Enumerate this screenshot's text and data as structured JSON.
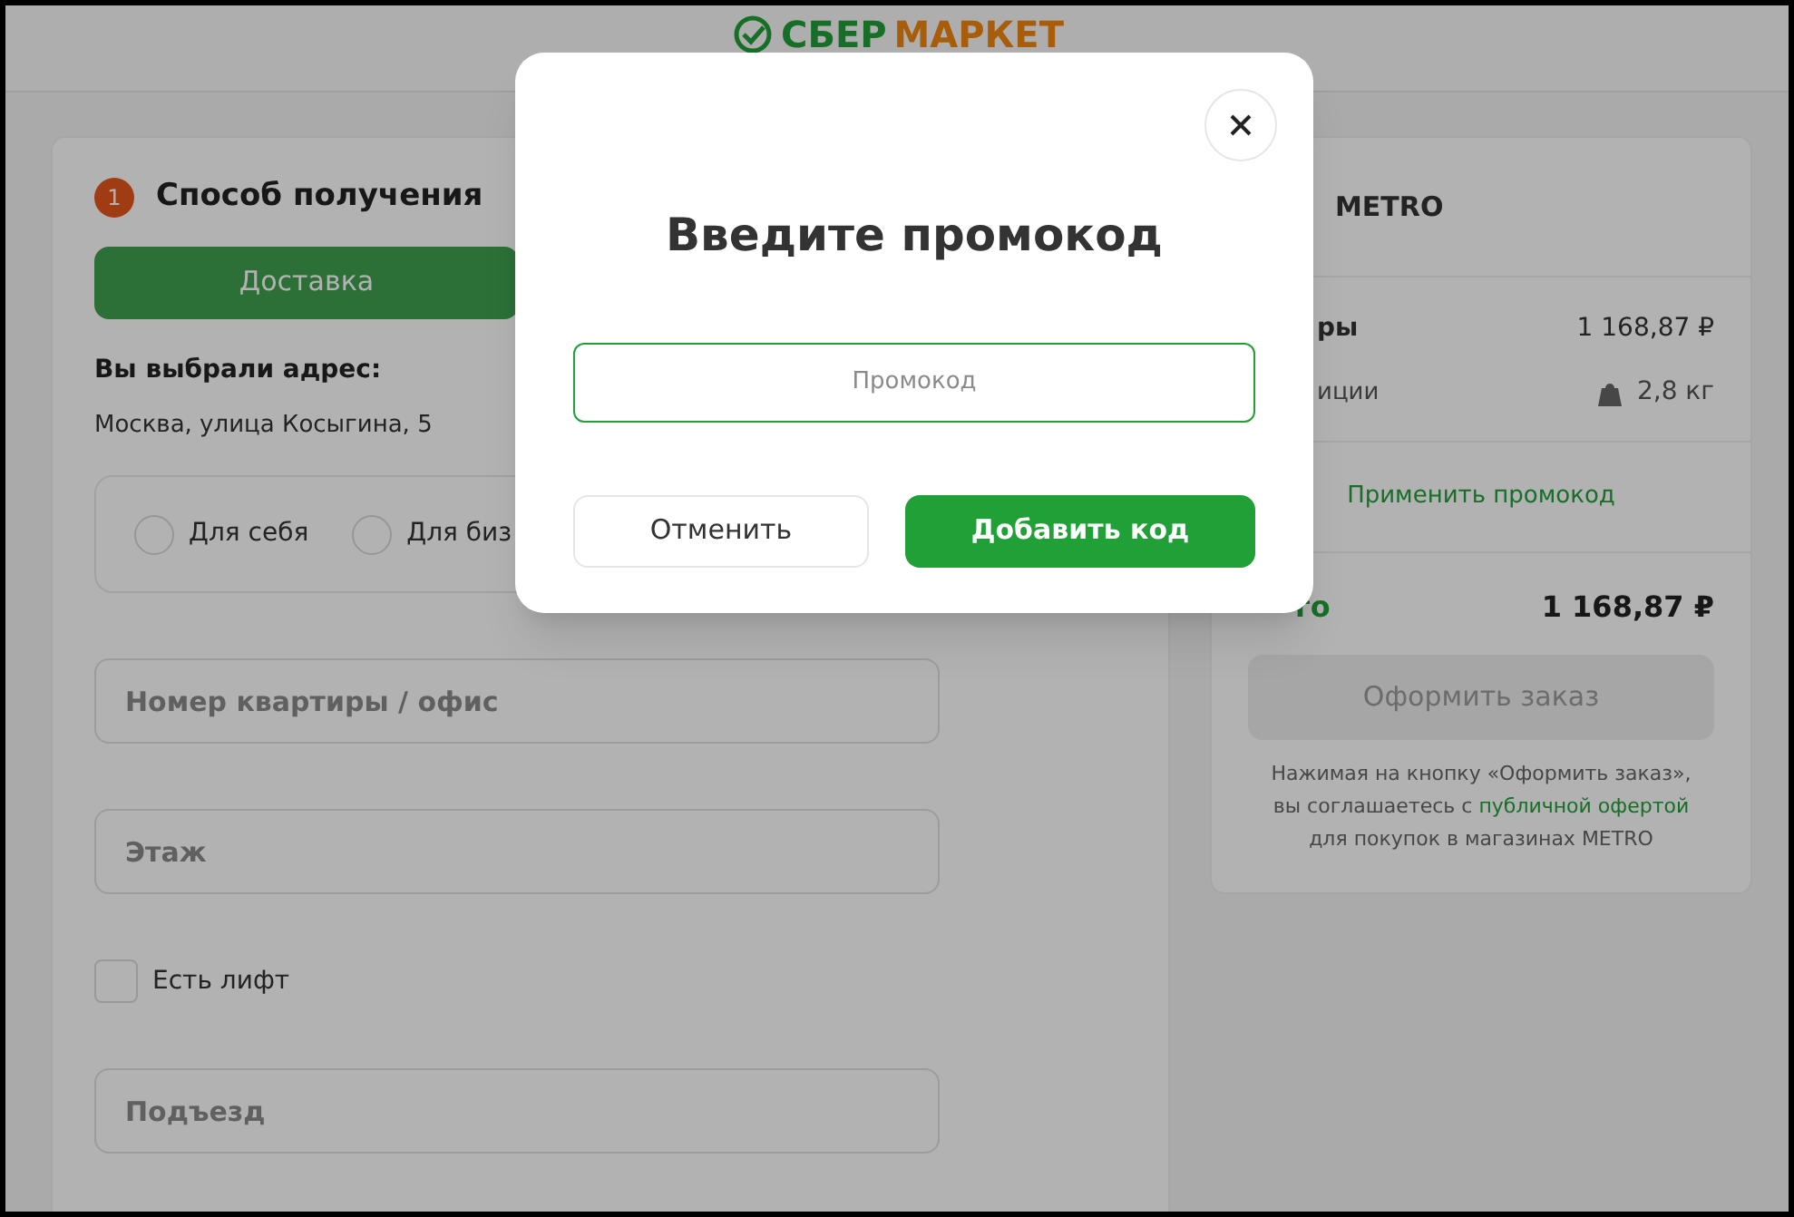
{
  "header": {
    "logo": {
      "part1": "СБЕР",
      "part2": "МАРКЕТ"
    }
  },
  "delivery": {
    "step": "1",
    "title": "Способ получения",
    "delivery_button": "Доставка",
    "address_label": "Вы выбрали адрес:",
    "address": "Москва, улица Косыгина, 5",
    "recipient_options": [
      {
        "label": "Для себя",
        "selected": false
      },
      {
        "label": "Для биз",
        "selected": false
      }
    ],
    "fields": [
      {
        "placeholder": "Номер квартиры / офис"
      },
      {
        "placeholder": "Этаж"
      }
    ],
    "elevator": {
      "label": "Есть лифт",
      "checked": false
    },
    "fields_2": [
      {
        "placeholder": "Подъезд"
      }
    ]
  },
  "summary": {
    "store": "METRO",
    "goods_label": "ры",
    "goods_total": "1 168,87 ₽",
    "positions_label": "иции",
    "weight": "2,8 кг",
    "promo_link": "Применить промокод",
    "total_label": "го",
    "total": "1 168,87 ₽",
    "checkout_button": "Оформить заказ",
    "disclaimer_before": "Нажимая на кнопку «Оформить заказ», вы соглашаетесь с",
    "disclaimer_link": "публичной офертой",
    "disclaimer_after": "для покупок в магазинах METRO"
  },
  "modal": {
    "title": "Введите промокод",
    "input": {
      "placeholder": "Промокод"
    },
    "cancel_button": "Отменить",
    "submit_button": "Добавить код"
  }
}
